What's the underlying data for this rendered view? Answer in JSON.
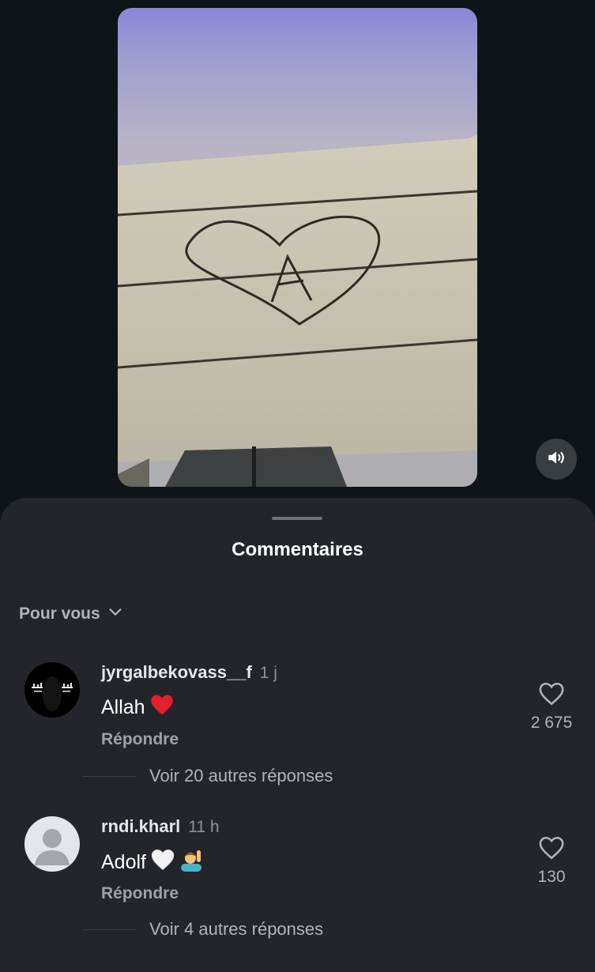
{
  "sheet": {
    "title": "Commentaires",
    "sort_label": "Pour vous"
  },
  "comments": [
    {
      "username": "jyrgalbekovass__f",
      "time": "1 j",
      "text": "Allah",
      "emojis": [
        "red-heart"
      ],
      "reply_label": "Répondre",
      "likes": "2 675",
      "more_replies": "Voir 20 autres réponses"
    },
    {
      "username": "rndi.kharl",
      "time": "11 h",
      "text": "Adolf",
      "emojis": [
        "white-heart",
        "person-raising-hand"
      ],
      "reply_label": "Répondre",
      "likes": "130",
      "more_replies": "Voir 4 autres réponses"
    }
  ],
  "colors": {
    "background": "#0f1418",
    "sheet": "#23252b",
    "secondary_text": "#b0b3b8",
    "heart_red": "#e0202c"
  }
}
